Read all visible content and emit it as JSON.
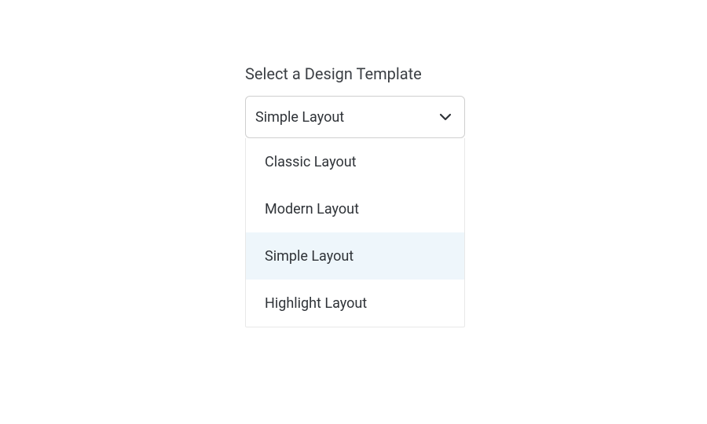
{
  "label": "Select a Design Template",
  "selected": "Simple Layout",
  "options": [
    {
      "label": "Classic Layout",
      "selected": false
    },
    {
      "label": "Modern Layout",
      "selected": false
    },
    {
      "label": "Simple Layout",
      "selected": true
    },
    {
      "label": "Highlight Layout",
      "selected": false
    }
  ]
}
